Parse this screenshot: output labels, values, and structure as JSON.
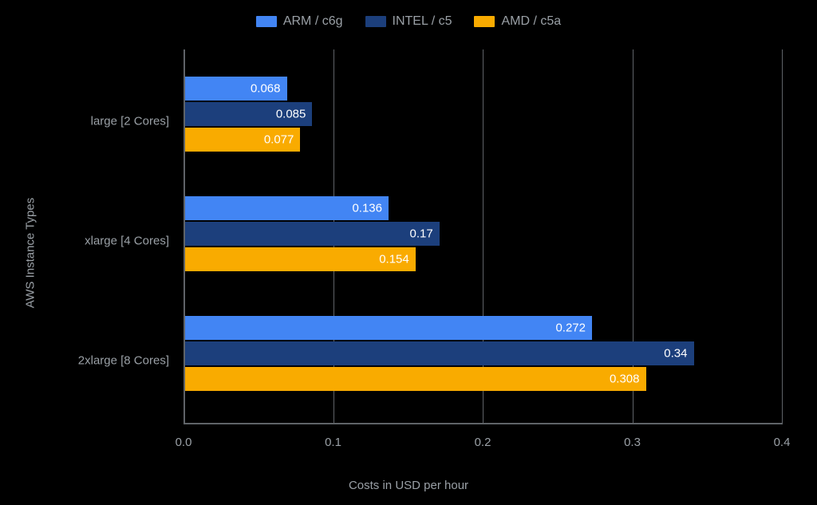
{
  "chart_data": {
    "type": "bar",
    "orientation": "horizontal",
    "categories": [
      "large [2 Cores]",
      "xlarge [4 Cores]",
      "2xlarge [8 Cores]"
    ],
    "series": [
      {
        "name": "ARM / c6g",
        "color": "#4285f4",
        "values": [
          0.068,
          0.136,
          0.272
        ]
      },
      {
        "name": "INTEL / c5",
        "color": "#1c3f7c",
        "values": [
          0.085,
          0.17,
          0.34
        ]
      },
      {
        "name": "AMD / c5a",
        "color": "#f9ab00",
        "values": [
          0.077,
          0.154,
          0.308
        ]
      }
    ],
    "xlabel": "Costs in USD per hour",
    "ylabel": "AWS Instance Types",
    "xlim": [
      0.0,
      0.4
    ],
    "xticks": [
      0.0,
      0.1,
      0.2,
      0.3,
      0.4
    ],
    "xtick_labels": [
      "0.0",
      "0.1",
      "0.2",
      "0.3",
      "0.4"
    ],
    "grid": "vertical",
    "legend_position": "top"
  }
}
